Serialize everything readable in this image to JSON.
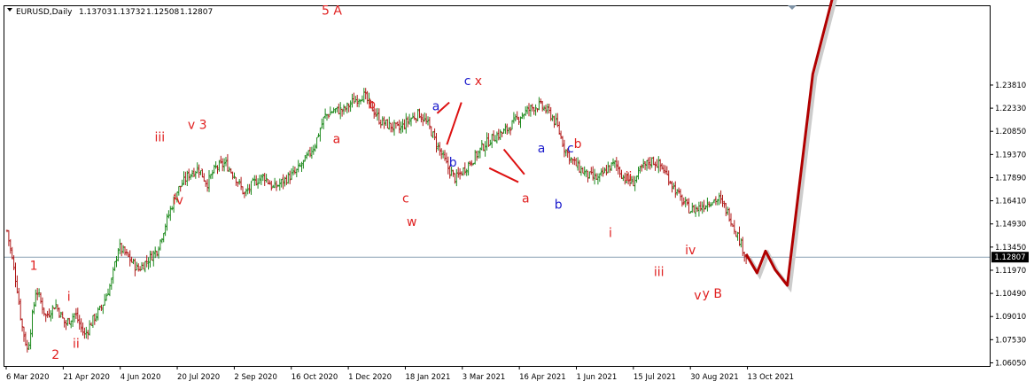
{
  "chart_data": {
    "type": "ohlc",
    "header": {
      "symbol": "EURUSD,Daily",
      "open": "1.13703",
      "high": "1.13732",
      "low": "1.12508",
      "close": "1.12807"
    },
    "ylim": [
      1.0585,
      1.2885
    ],
    "y_ticks": [
      "1.06050",
      "1.07530",
      "1.09010",
      "1.10490",
      "1.11970",
      "1.13450",
      "1.14930",
      "1.16410",
      "1.17890",
      "1.19370",
      "1.20850",
      "1.22330",
      "1.23810"
    ],
    "current_price": "1.12807",
    "x_ticks": [
      "6 Mar 2020",
      "21 Apr 2020",
      "4 Jun 2020",
      "20 Jul 2020",
      "2 Sep 2020",
      "16 Oct 2020",
      "1 Dec 2020",
      "18 Jan 2021",
      "3 Mar 2021",
      "16 Apr 2021",
      "1 Jun 2021",
      "15 Jul 2021",
      "30 Aug 2021",
      "13 Oct 2021"
    ],
    "bar_count": 440,
    "path_closes": [
      [
        0,
        1.145
      ],
      [
        8,
        1.11
      ],
      [
        12,
        1.085
      ],
      [
        17,
        1.068
      ],
      [
        24,
        1.108
      ],
      [
        32,
        1.09
      ],
      [
        40,
        1.098
      ],
      [
        48,
        1.085
      ],
      [
        56,
        1.092
      ],
      [
        64,
        1.078
      ],
      [
        70,
        1.087
      ],
      [
        78,
        1.096
      ],
      [
        86,
        1.112
      ],
      [
        92,
        1.135
      ],
      [
        100,
        1.128
      ],
      [
        108,
        1.12
      ],
      [
        116,
        1.126
      ],
      [
        124,
        1.133
      ],
      [
        132,
        1.152
      ],
      [
        140,
        1.17
      ],
      [
        150,
        1.181
      ],
      [
        158,
        1.185
      ],
      [
        165,
        1.175
      ],
      [
        172,
        1.185
      ],
      [
        180,
        1.188
      ],
      [
        188,
        1.18
      ],
      [
        196,
        1.168
      ],
      [
        204,
        1.176
      ],
      [
        212,
        1.18
      ],
      [
        220,
        1.172
      ],
      [
        230,
        1.178
      ],
      [
        238,
        1.182
      ],
      [
        246,
        1.19
      ],
      [
        254,
        1.2
      ],
      [
        262,
        1.218
      ],
      [
        270,
        1.222
      ],
      [
        278,
        1.222
      ],
      [
        286,
        1.228
      ],
      [
        294,
        1.232
      ],
      [
        300,
        1.225
      ],
      [
        308,
        1.215
      ],
      [
        316,
        1.212
      ],
      [
        324,
        1.21
      ],
      [
        332,
        1.216
      ],
      [
        340,
        1.22
      ],
      [
        348,
        1.212
      ],
      [
        356,
        1.198
      ],
      [
        364,
        1.185
      ],
      [
        370,
        1.178
      ],
      [
        378,
        1.185
      ],
      [
        386,
        1.192
      ],
      [
        394,
        1.2
      ],
      [
        402,
        1.205
      ],
      [
        410,
        1.208
      ],
      [
        418,
        1.214
      ],
      [
        426,
        1.22
      ],
      [
        434,
        1.224
      ],
      [
        440,
        1.225
      ],
      [
        448,
        1.22
      ],
      [
        454,
        1.212
      ],
      [
        460,
        1.198
      ],
      [
        466,
        1.19
      ],
      [
        472,
        1.185
      ],
      [
        480,
        1.18
      ],
      [
        488,
        1.178
      ],
      [
        496,
        1.185
      ],
      [
        502,
        1.188
      ],
      [
        508,
        1.18
      ],
      [
        516,
        1.175
      ],
      [
        524,
        1.185
      ],
      [
        532,
        1.19
      ],
      [
        540,
        1.186
      ],
      [
        548,
        1.176
      ],
      [
        556,
        1.165
      ],
      [
        564,
        1.158
      ],
      [
        572,
        1.16
      ],
      [
        580,
        1.164
      ],
      [
        588,
        1.165
      ],
      [
        596,
        1.155
      ],
      [
        604,
        1.14
      ],
      [
        610,
        1.128
      ]
    ],
    "projection": [
      [
        610,
        1.13
      ],
      [
        619,
        1.118
      ],
      [
        626,
        1.132
      ],
      [
        634,
        1.12
      ],
      [
        644,
        1.11
      ],
      [
        665,
        1.245
      ],
      [
        700,
        1.35
      ]
    ],
    "wave_labels": [
      {
        "text": "5 A",
        "x": 268,
        "y": 1.283,
        "color": "red"
      },
      {
        "text": "v 3",
        "x": 157,
        "y": 1.21,
        "color": "red"
      },
      {
        "text": "iii",
        "x": 126,
        "y": 1.202,
        "color": "red"
      },
      {
        "text": "iv",
        "x": 141,
        "y": 1.162,
        "color": "red"
      },
      {
        "text": "1",
        "x": 22,
        "y": 1.12,
        "color": "red"
      },
      {
        "text": "2",
        "x": 40,
        "y": 1.063,
        "color": "red"
      },
      {
        "text": "i",
        "x": 51,
        "y": 1.1,
        "color": "red"
      },
      {
        "text": "ii",
        "x": 57,
        "y": 1.07,
        "color": "red"
      },
      {
        "text": "a",
        "x": 272,
        "y": 1.201,
        "color": "red"
      },
      {
        "text": "b",
        "x": 301,
        "y": 1.223,
        "color": "red"
      },
      {
        "text": "c",
        "x": 329,
        "y": 1.163,
        "color": "red"
      },
      {
        "text": "w",
        "x": 334,
        "y": 1.148,
        "color": "red"
      },
      {
        "text": "a",
        "x": 354,
        "y": 1.222,
        "color": "blue"
      },
      {
        "text": "b",
        "x": 368,
        "y": 1.186,
        "color": "blue"
      },
      {
        "text": "c",
        "x": 380,
        "y": 1.238,
        "color": "blue"
      },
      {
        "text": "x",
        "x": 389,
        "y": 1.238,
        "color": "red"
      },
      {
        "text": "a",
        "x": 441,
        "y": 1.195,
        "color": "blue"
      },
      {
        "text": "a",
        "x": 428,
        "y": 1.163,
        "color": "red"
      },
      {
        "text": "b",
        "x": 455,
        "y": 1.159,
        "color": "blue"
      },
      {
        "text": "c",
        "x": 465,
        "y": 1.195,
        "color": "blue"
      },
      {
        "text": "b",
        "x": 471,
        "y": 1.198,
        "color": "red"
      },
      {
        "text": "ii",
        "x": 513,
        "y": 1.177,
        "color": "red"
      },
      {
        "text": "i",
        "x": 498,
        "y": 1.141,
        "color": "red"
      },
      {
        "text": "iii",
        "x": 538,
        "y": 1.116,
        "color": "red"
      },
      {
        "text": "iv",
        "x": 564,
        "y": 1.13,
        "color": "red"
      },
      {
        "text": "v",
        "x": 570,
        "y": 1.101,
        "color": "red"
      },
      {
        "text": "y B",
        "x": 582,
        "y": 1.102,
        "color": "red"
      }
    ],
    "wave_lines": [
      [
        [
          355,
          1.22
        ],
        [
          365,
          1.227
        ]
      ],
      [
        [
          363,
          1.2
        ],
        [
          375,
          1.227
        ]
      ],
      [
        [
          398,
          1.185
        ],
        [
          422,
          1.176
        ]
      ],
      [
        [
          410,
          1.197
        ],
        [
          427,
          1.181
        ]
      ]
    ]
  }
}
